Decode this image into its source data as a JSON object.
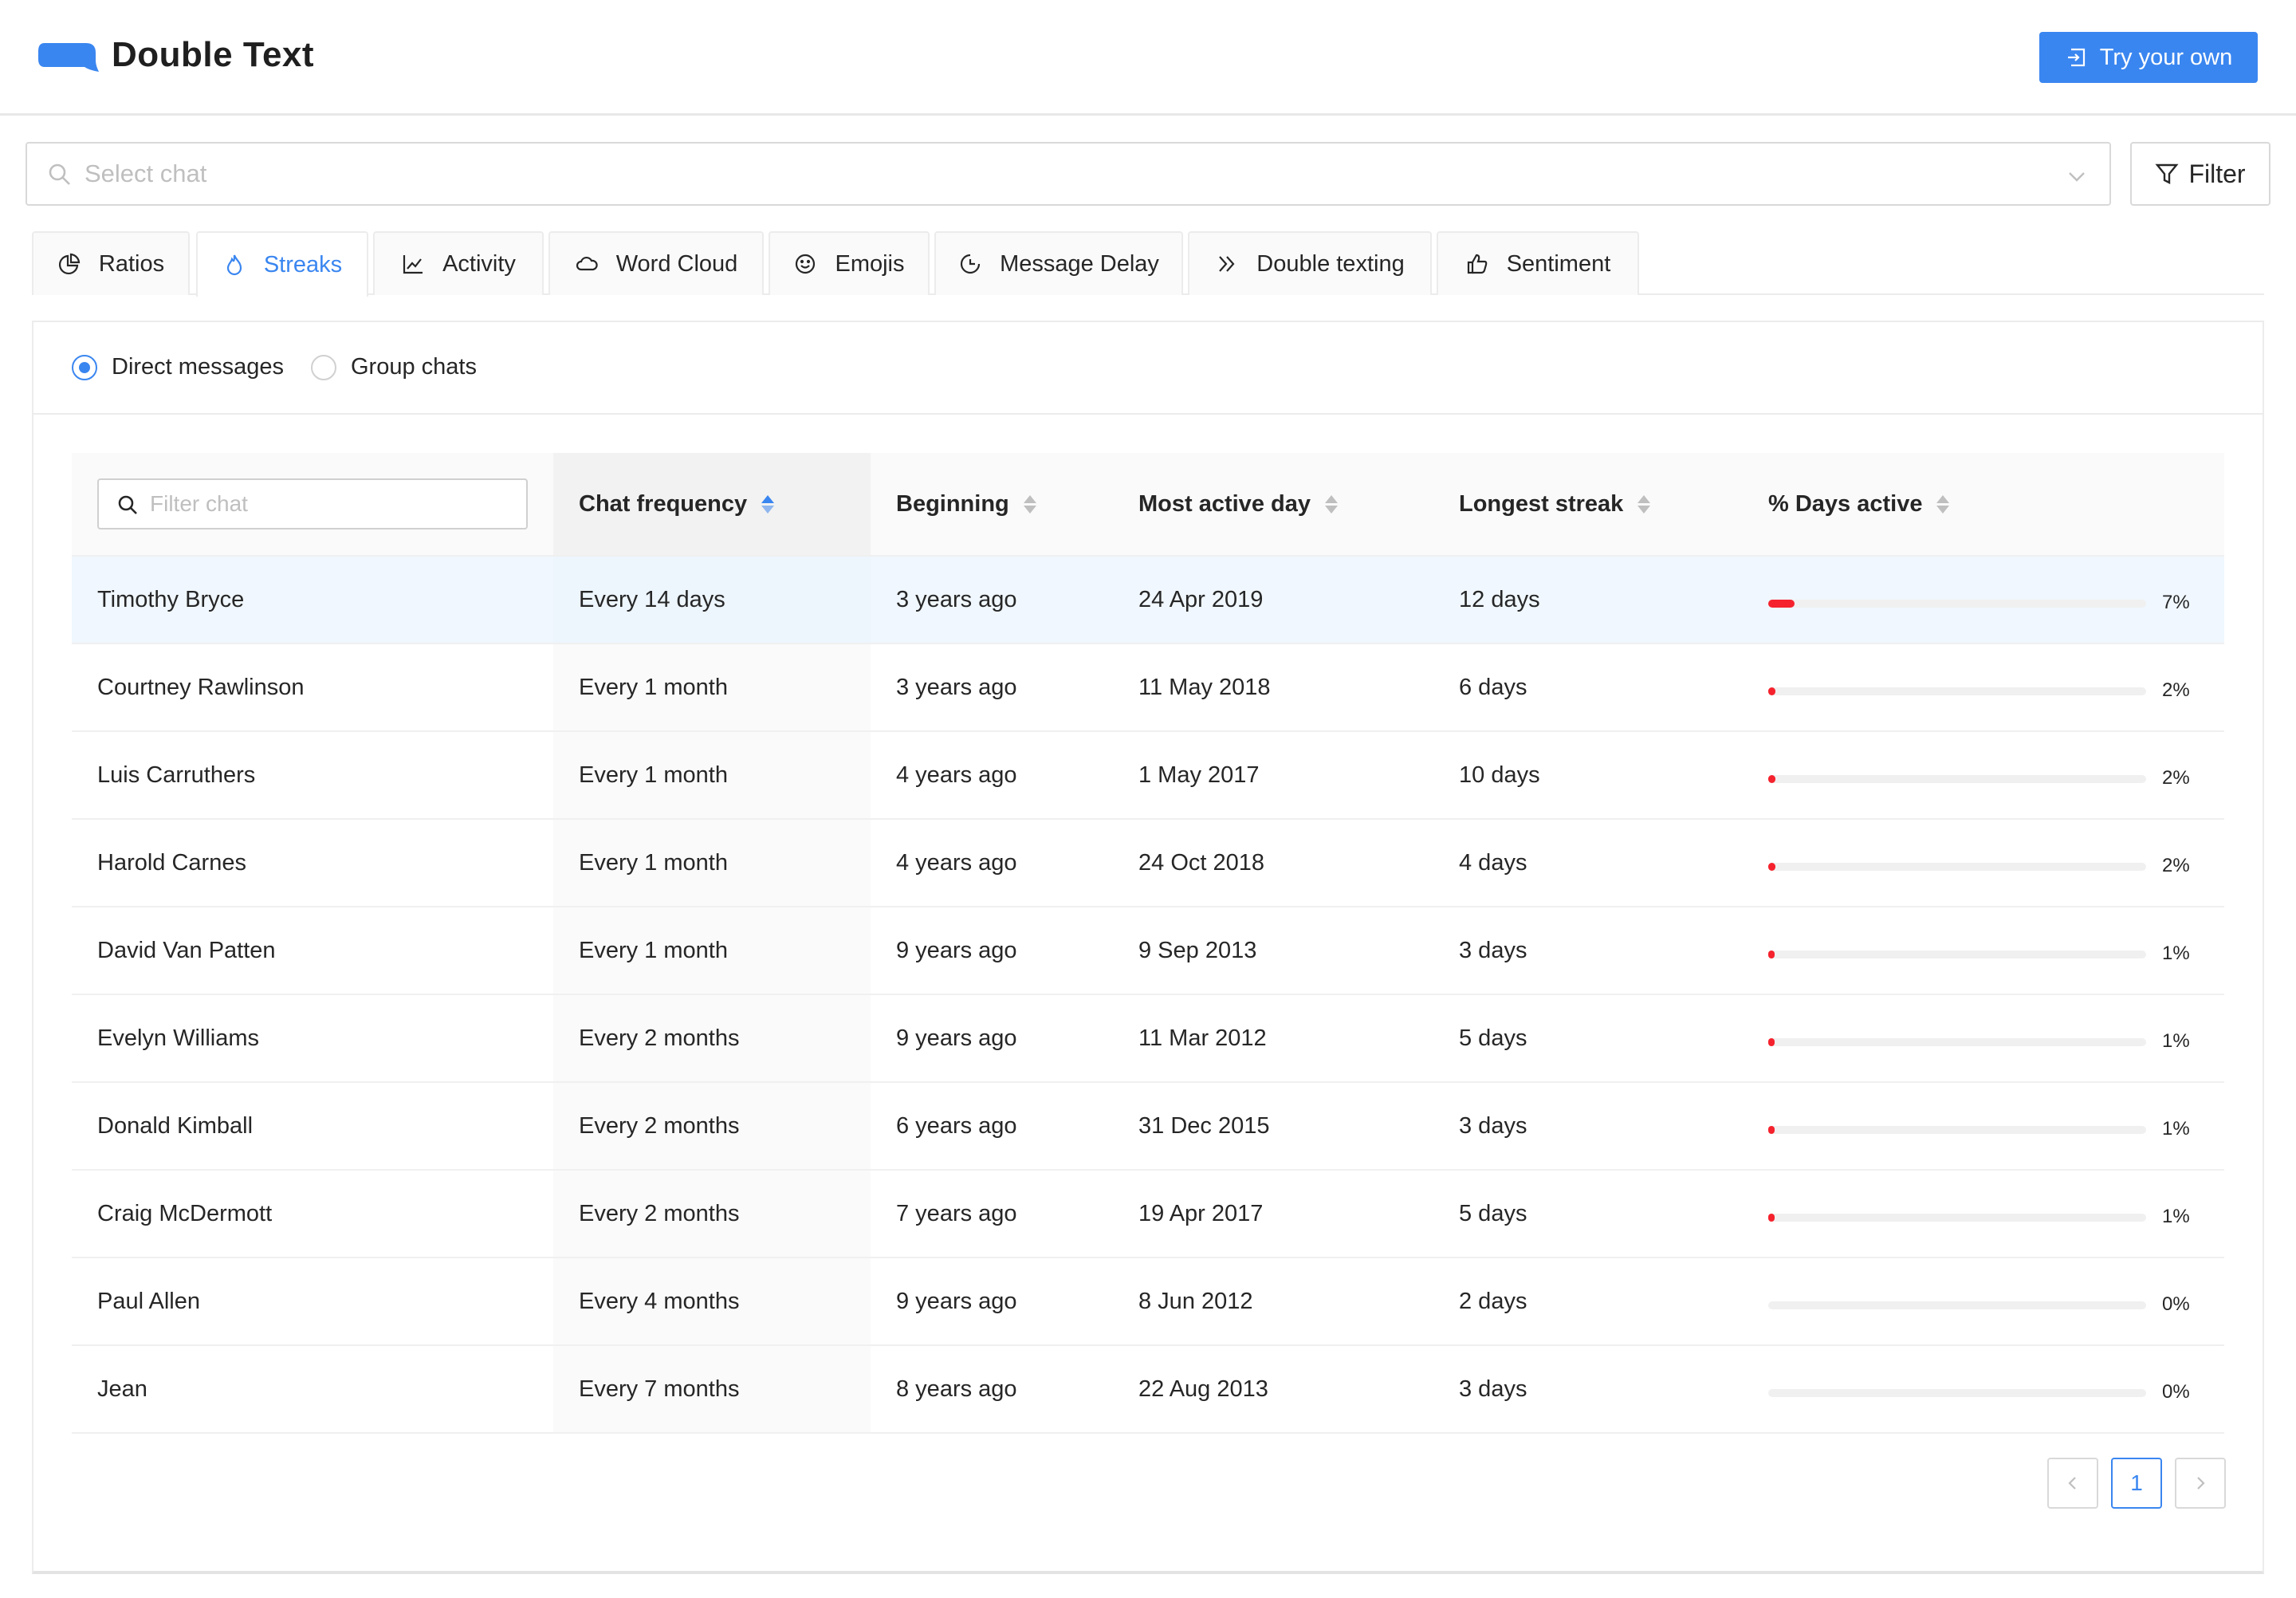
{
  "header": {
    "app_name": "Double Text",
    "logo_icon": "speech-bubble-icon",
    "try_button": "Try your own",
    "brand_color": "#3a86f0"
  },
  "chat_select": {
    "placeholder": "Select chat"
  },
  "filter_button": "Filter",
  "tabs": [
    {
      "label": "Ratios",
      "icon": "pie-chart-icon"
    },
    {
      "label": "Streaks",
      "icon": "flame-icon",
      "active": true
    },
    {
      "label": "Activity",
      "icon": "line-chart-icon"
    },
    {
      "label": "Word Cloud",
      "icon": "cloud-icon"
    },
    {
      "label": "Emojis",
      "icon": "smile-icon"
    },
    {
      "label": "Message Delay",
      "icon": "clock-icon"
    },
    {
      "label": "Double texting",
      "icon": "double-chevron-icon"
    },
    {
      "label": "Sentiment",
      "icon": "thumbs-up-icon"
    }
  ],
  "chat_type": {
    "options": [
      "Direct messages",
      "Group chats"
    ],
    "selected": "Direct messages"
  },
  "table": {
    "filter_placeholder": "Filter chat",
    "columns": [
      "Chat frequency",
      "Beginning",
      "Most active day",
      "Longest streak",
      "% Days active"
    ],
    "sorted_column": "Chat frequency",
    "rows": [
      {
        "name": "Timothy Bryce",
        "frequency": "Every 14 days",
        "beginning": "3 years ago",
        "most_active": "24 Apr 2019",
        "streak": "12 days",
        "pct_label": "7%",
        "pct": 7
      },
      {
        "name": "Courtney Rawlinson",
        "frequency": "Every 1 month",
        "beginning": "3 years ago",
        "most_active": "11 May 2018",
        "streak": "6 days",
        "pct_label": "2%",
        "pct": 2
      },
      {
        "name": "Luis Carruthers",
        "frequency": "Every 1 month",
        "beginning": "4 years ago",
        "most_active": "1 May 2017",
        "streak": "10 days",
        "pct_label": "2%",
        "pct": 2
      },
      {
        "name": "Harold Carnes",
        "frequency": "Every 1 month",
        "beginning": "4 years ago",
        "most_active": "24 Oct 2018",
        "streak": "4 days",
        "pct_label": "2%",
        "pct": 2
      },
      {
        "name": "David Van Patten",
        "frequency": "Every 1 month",
        "beginning": "9 years ago",
        "most_active": "9 Sep 2013",
        "streak": "3 days",
        "pct_label": "1%",
        "pct": 1
      },
      {
        "name": "Evelyn Williams",
        "frequency": "Every 2 months",
        "beginning": "9 years ago",
        "most_active": "11 Mar 2012",
        "streak": "5 days",
        "pct_label": "1%",
        "pct": 1
      },
      {
        "name": "Donald Kimball",
        "frequency": "Every 2 months",
        "beginning": "6 years ago",
        "most_active": "31 Dec 2015",
        "streak": "3 days",
        "pct_label": "1%",
        "pct": 1
      },
      {
        "name": "Craig McDermott",
        "frequency": "Every 2 months",
        "beginning": "7 years ago",
        "most_active": "19 Apr 2017",
        "streak": "5 days",
        "pct_label": "1%",
        "pct": 1
      },
      {
        "name": "Paul Allen",
        "frequency": "Every 4 months",
        "beginning": "9 years ago",
        "most_active": "8 Jun 2012",
        "streak": "2 days",
        "pct_label": "0%",
        "pct": 0
      },
      {
        "name": "Jean",
        "frequency": "Every 7 months",
        "beginning": "8 years ago",
        "most_active": "22 Aug 2013",
        "streak": "3 days",
        "pct_label": "0%",
        "pct": 0
      }
    ]
  },
  "pagination": {
    "current_page": "1"
  },
  "colors": {
    "progress": "#f5222d",
    "accent": "#3a86f0"
  }
}
